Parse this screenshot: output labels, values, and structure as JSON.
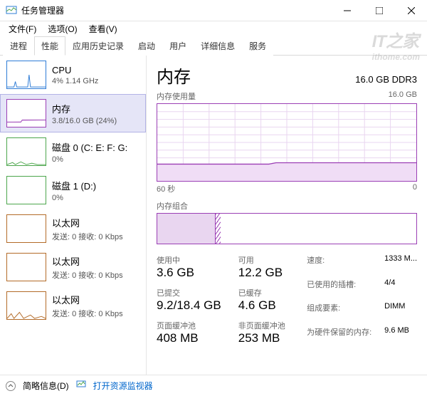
{
  "window": {
    "title": "任务管理器"
  },
  "menu": {
    "file": "文件(F)",
    "options": "选项(O)",
    "view": "查看(V)"
  },
  "tabs": [
    "进程",
    "性能",
    "应用历史记录",
    "启动",
    "用户",
    "详细信息",
    "服务"
  ],
  "active_tab_index": 1,
  "sidebar": {
    "items": [
      {
        "title": "CPU",
        "sub": "4% 1.14 GHz",
        "type": "cpu"
      },
      {
        "title": "内存",
        "sub": "3.8/16.0 GB (24%)",
        "type": "mem",
        "selected": true
      },
      {
        "title": "磁盘 0 (C: E: F: G:",
        "sub": "0%",
        "type": "disk"
      },
      {
        "title": "磁盘 1 (D:)",
        "sub": "0%",
        "type": "disk"
      },
      {
        "title": "以太网",
        "sub": "发送: 0 接收: 0 Kbps",
        "type": "net"
      },
      {
        "title": "以太网",
        "sub": "发送: 0 接收: 0 Kbps",
        "type": "net"
      },
      {
        "title": "以太网",
        "sub": "发送: 0 接收: 0 Kbps",
        "type": "net"
      }
    ]
  },
  "detail": {
    "title": "内存",
    "caps": "16.0 GB DDR3",
    "usage_label": "内存使用量",
    "usage_max": "16.0 GB",
    "x_left": "60 秒",
    "x_right": "0",
    "comp_label": "内存组合",
    "stats": {
      "in_use_lbl": "使用中",
      "in_use": "3.6 GB",
      "avail_lbl": "可用",
      "avail": "12.2 GB",
      "commit_lbl": "已提交",
      "commit": "9.2/18.4 GB",
      "cached_lbl": "已缓存",
      "cached": "4.6 GB",
      "paged_lbl": "页面缓冲池",
      "paged": "408 MB",
      "nonpaged_lbl": "非页面缓冲池",
      "nonpaged": "253 MB"
    },
    "right": {
      "speed_lbl": "速度:",
      "speed": "1333 M...",
      "slots_lbl": "已使用的插槽:",
      "slots": "4/4",
      "form_lbl": "组成要素:",
      "form": "DIMM",
      "hw_lbl": "为硬件保留的内存:",
      "hw": "9.6 MB"
    }
  },
  "footer": {
    "less": "简略信息(D)",
    "monitor": "打开资源监视器"
  },
  "watermark": {
    "brand": "IT之家",
    "url": "ithome.com"
  },
  "chart_data": {
    "type": "line",
    "title": "内存使用量",
    "ylabel": "GB",
    "ylim": [
      0,
      16
    ],
    "xlabel": "秒",
    "xlim": [
      60,
      0
    ],
    "series": [
      {
        "name": "内存",
        "values_gb_estimate": [
          3.5,
          3.5,
          3.5,
          3.5,
          3.5,
          3.5,
          3.5,
          3.6,
          3.8,
          3.8,
          3.8,
          3.8,
          3.8,
          3.8,
          3.8
        ]
      }
    ],
    "composition_estimate": {
      "in_use_gb": 3.6,
      "modified_gb": 0.2,
      "total_gb": 16.0
    }
  }
}
